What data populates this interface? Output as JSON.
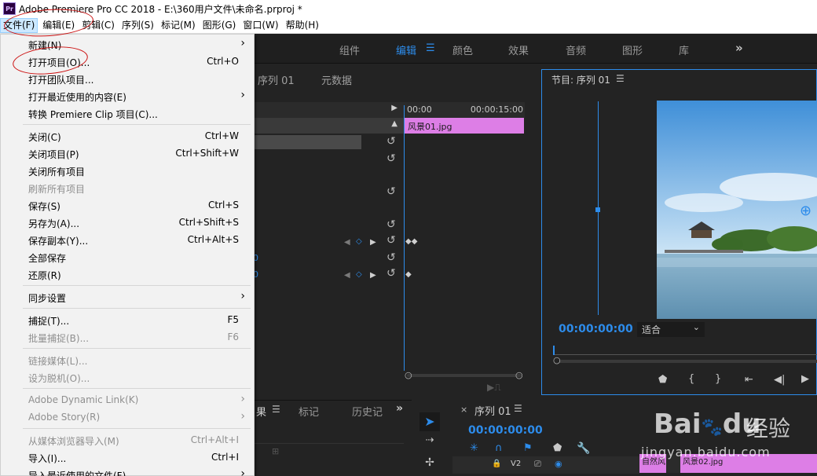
{
  "app": {
    "title": "Adobe Premiere Pro CC 2018 - E:\\360用户文件\\未命名.prproj *",
    "logo_text": "Pr"
  },
  "menubar": {
    "items": [
      "文件(F)",
      "编辑(E)",
      "剪辑(C)",
      "序列(S)",
      "标记(M)",
      "图形(G)",
      "窗口(W)",
      "帮助(H)"
    ]
  },
  "workspace": {
    "tabs": [
      "组件",
      "编辑",
      "颜色",
      "效果",
      "音频",
      "图形",
      "库"
    ],
    "active_tab": "编辑",
    "more": "»"
  },
  "effect_controls": {
    "tabs": [
      "序列 01",
      "元数据"
    ],
    "ruler_start": "00:00",
    "ruler_end": "00:00:15:00",
    "clip_name": "风景01.jpg",
    "value_fragments": [
      "0",
      "0"
    ]
  },
  "program_monitor": {
    "title": "节目: 序列 01",
    "timecode": "00:00:00:00",
    "fit_label": "适合"
  },
  "bottom_left": {
    "tabs": [
      "果",
      "标记",
      "历史记"
    ],
    "more": "»"
  },
  "timeline": {
    "title": "序列 01",
    "timecode": "00:00:00:00",
    "track_label": "V2",
    "clips": [
      "自然风",
      "风景02.jpg"
    ]
  },
  "file_menu": {
    "items": [
      {
        "label": "新建(N)",
        "shortcut": "",
        "submenu": true,
        "disabled": false
      },
      {
        "label": "打开项目(O)...",
        "shortcut": "Ctrl+O",
        "submenu": false,
        "disabled": false
      },
      {
        "label": "打开团队项目...",
        "shortcut": "",
        "submenu": false,
        "disabled": false
      },
      {
        "label": "打开最近使用的内容(E)",
        "shortcut": "",
        "submenu": true,
        "disabled": false
      },
      {
        "label": "转换 Premiere Clip 项目(C)...",
        "shortcut": "",
        "submenu": false,
        "disabled": false
      },
      {
        "label": "关闭(C)",
        "shortcut": "Ctrl+W",
        "submenu": false,
        "disabled": false
      },
      {
        "label": "关闭项目(P)",
        "shortcut": "Ctrl+Shift+W",
        "submenu": false,
        "disabled": false
      },
      {
        "label": "关闭所有项目",
        "shortcut": "",
        "submenu": false,
        "disabled": false
      },
      {
        "label": "刷新所有项目",
        "shortcut": "",
        "submenu": false,
        "disabled": true
      },
      {
        "label": "保存(S)",
        "shortcut": "Ctrl+S",
        "submenu": false,
        "disabled": false
      },
      {
        "label": "另存为(A)...",
        "shortcut": "Ctrl+Shift+S",
        "submenu": false,
        "disabled": false
      },
      {
        "label": "保存副本(Y)...",
        "shortcut": "Ctrl+Alt+S",
        "submenu": false,
        "disabled": false
      },
      {
        "label": "全部保存",
        "shortcut": "",
        "submenu": false,
        "disabled": false
      },
      {
        "label": "还原(R)",
        "shortcut": "",
        "submenu": false,
        "disabled": false
      },
      {
        "label": "同步设置",
        "shortcut": "",
        "submenu": true,
        "disabled": false
      },
      {
        "label": "捕捉(T)...",
        "shortcut": "F5",
        "submenu": false,
        "disabled": false
      },
      {
        "label": "批量捕捉(B)...",
        "shortcut": "F6",
        "submenu": false,
        "disabled": true
      },
      {
        "label": "链接媒体(L)...",
        "shortcut": "",
        "submenu": false,
        "disabled": true
      },
      {
        "label": "设为脱机(O)...",
        "shortcut": "",
        "submenu": false,
        "disabled": true
      },
      {
        "label": "Adobe Dynamic Link(K)",
        "shortcut": "",
        "submenu": true,
        "disabled": true
      },
      {
        "label": "Adobe Story(R)",
        "shortcut": "",
        "submenu": true,
        "disabled": true
      },
      {
        "label": "从媒体浏览器导入(M)",
        "shortcut": "Ctrl+Alt+I",
        "submenu": false,
        "disabled": true
      },
      {
        "label": "导入(I)...",
        "shortcut": "Ctrl+I",
        "submenu": false,
        "disabled": false
      },
      {
        "label": "导入最近使用的文件(F)",
        "shortcut": "",
        "submenu": true,
        "disabled": false
      }
    ]
  },
  "watermark": {
    "brand": "Bai",
    "brand_tail": "du",
    "cn": "经验",
    "url": "jingyan.baidu.com"
  },
  "colors": {
    "accent_blue": "#2d8ceb",
    "clip_pink": "#dd7ee6",
    "annotation_red": "#cc1111"
  }
}
